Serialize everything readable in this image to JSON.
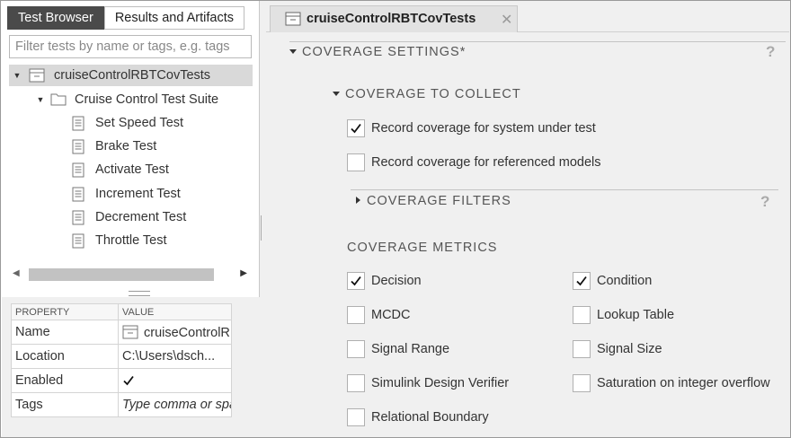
{
  "left_panel": {
    "tabs": [
      {
        "label": "Test Browser",
        "active": true
      },
      {
        "label": "Results and Artifacts",
        "active": false
      }
    ],
    "filter_placeholder": "Filter tests by name or tags, e.g. tags",
    "tree": {
      "file": "cruiseControlRBTCovTests",
      "suite": "Cruise Control Test Suite",
      "tests": [
        "Set Speed Test",
        "Brake Test",
        "Activate Test",
        "Increment Test",
        "Decrement Test",
        "Throttle Test"
      ]
    },
    "properties": {
      "header_property": "PROPERTY",
      "header_value": "VALUE",
      "rows": [
        {
          "key": "Name",
          "value": "cruiseControlRBTCovTests"
        },
        {
          "key": "Location",
          "value": "C:\\Users\\dsch..."
        },
        {
          "key": "Enabled",
          "value": ""
        },
        {
          "key": "Tags",
          "value": ""
        }
      ],
      "enabled_checked": true,
      "tags_placeholder": "Type comma or space separated tags"
    }
  },
  "document_tab": {
    "title": "cruiseControlRBTCovTests",
    "close_glyph": "✕"
  },
  "coverage": {
    "settings_title": "COVERAGE SETTINGS*",
    "collect_title": "COVERAGE TO COLLECT",
    "record_system": {
      "label": "Record coverage for system under test",
      "checked": true
    },
    "record_referenced": {
      "label": "Record coverage for referenced models",
      "checked": false
    },
    "filters_title": "COVERAGE FILTERS",
    "metrics_title": "COVERAGE METRICS",
    "help_glyph": "?",
    "metrics": [
      {
        "label": "Decision",
        "checked": true
      },
      {
        "label": "Condition",
        "checked": true
      },
      {
        "label": "MCDC",
        "checked": false
      },
      {
        "label": "Lookup Table",
        "checked": false
      },
      {
        "label": "Signal Range",
        "checked": false
      },
      {
        "label": "Signal Size",
        "checked": false
      },
      {
        "label": "Simulink Design Verifier",
        "checked": false
      },
      {
        "label": "Saturation on integer overflow",
        "checked": false
      },
      {
        "label": "Relational Boundary",
        "checked": false
      }
    ]
  }
}
